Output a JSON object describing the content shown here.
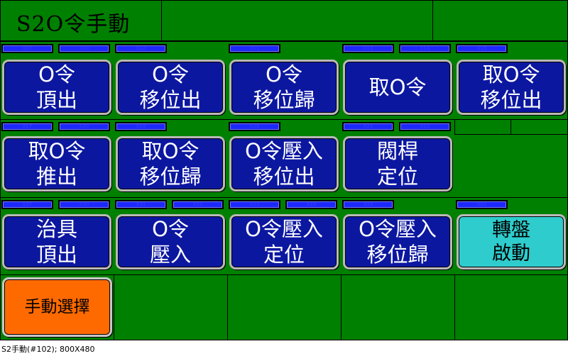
{
  "title": "S2O令手動",
  "buttons": [
    {
      "label": "O令\n頂出",
      "tag": "X07"
    },
    {
      "label": "O令\n移位出",
      "tag": "X12"
    },
    {
      "label": "O令\n移位歸",
      "tag": "X11"
    },
    {
      "label": "取O令",
      "tag": "X13"
    },
    {
      "label": "取O令\n移位出",
      "tag": "X15"
    },
    {
      "label": "取O令\n推出",
      "tag": "X17"
    },
    {
      "label": "取O令\n移位歸",
      "tag": "X16"
    },
    {
      "label": "O令壓入\n移位出",
      "tag": "X26"
    },
    {
      "label": "閥桿\n定位",
      "tag": "X21"
    },
    {
      "label": "治具\n頂出",
      "tag": "X27"
    },
    {
      "label": "O令\n壓入",
      "tag": "X31"
    },
    {
      "label": "O令壓入\n定位",
      "tag": "X23"
    },
    {
      "label": "O令壓入\n移位歸",
      "tag": "X25"
    },
    {
      "label": "轉盤\n啟動",
      "tag": "X01"
    },
    {
      "label": "手動選擇"
    }
  ],
  "extra_tags": [
    "X10",
    "X14",
    "X20",
    "X22",
    "X30",
    "X32",
    "X24"
  ],
  "status_bar": "S2手動(#102); 800X480",
  "colors": {
    "background": "#008000",
    "button": "#0c17a0",
    "button_cyan": "#2ecccc",
    "button_orange": "#ff6a00",
    "tag": "#1d28ff"
  }
}
